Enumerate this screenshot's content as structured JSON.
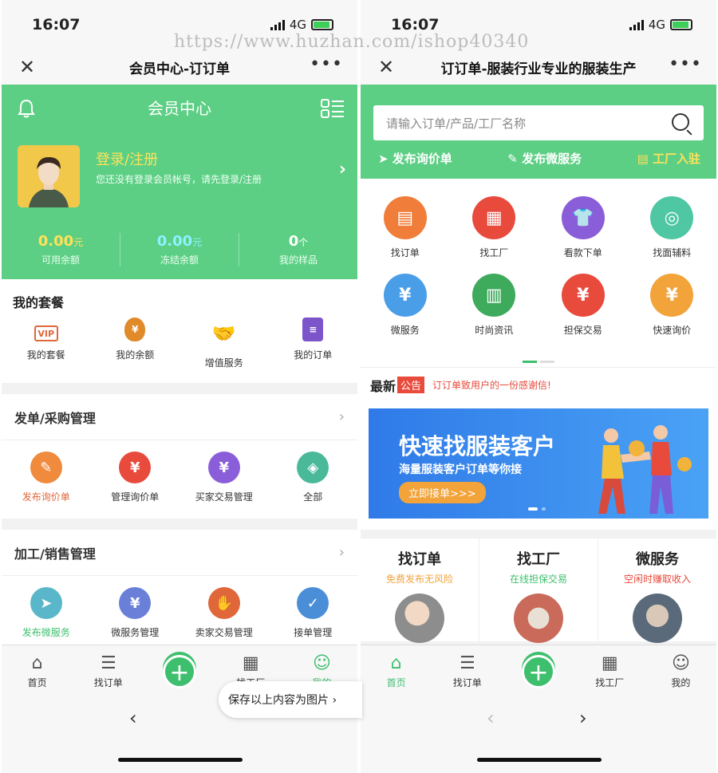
{
  "watermark": "https://www.huzhan.com/ishop40340",
  "left": {
    "status": {
      "time": "16:07",
      "net": "4G"
    },
    "nav": {
      "title": "会员中心-订订单"
    },
    "header": {
      "title": "会员中心",
      "login": "登录/注册",
      "sub": "您还没有登录会员帐号，请先登录/注册"
    },
    "stats": [
      {
        "value": "0.00",
        "unit": "元",
        "label": "可用余额",
        "color": "#ffe25a"
      },
      {
        "value": "0.00",
        "unit": "元",
        "label": "冻结余额",
        "color": "#8ff0ff"
      },
      {
        "value": "0",
        "unit": "个",
        "label": "我的样品",
        "color": "#ffffff"
      }
    ],
    "package": {
      "title": "我的套餐",
      "items": [
        "我的套餐",
        "我的余额",
        "增值服务",
        "我的订单"
      ]
    },
    "purchase": {
      "title": "发单/采购管理",
      "items": [
        "发布询价单",
        "管理询价单",
        "买家交易管理",
        "全部"
      ]
    },
    "sales": {
      "title": "加工/销售管理",
      "items": [
        "发布微服务",
        "微服务管理",
        "卖家交易管理",
        "接单管理"
      ]
    },
    "tabs": [
      "首页",
      "找订单",
      "",
      "找工厂",
      "我的"
    ],
    "save_tip": "保存以上内容为图片 ›"
  },
  "right": {
    "status": {
      "time": "16:07",
      "net": "4G"
    },
    "nav": {
      "title": "订订单-服装行业专业的服装生产"
    },
    "search_placeholder": "请输入订单/产品/工厂名称",
    "links": [
      "发布询价单",
      "发布微服务",
      "工厂入驻"
    ],
    "grid": [
      "找订单",
      "找工厂",
      "看款下单",
      "找面辅料",
      "微服务",
      "时尚资讯",
      "担保交易",
      "快速询价"
    ],
    "notice": {
      "title": "最新",
      "badge": "公告",
      "text": "订订单致用户的一份感谢信!"
    },
    "banner": {
      "title": "快速找服装客户",
      "sub": "海量服装客户订单等你接",
      "button": "立即接单>>>"
    },
    "cards": [
      {
        "title": "找订单",
        "sub": "免费发布无风险",
        "color": "#f2a33a"
      },
      {
        "title": "找工厂",
        "sub": "在线担保交易",
        "color": "#3ebf6e"
      },
      {
        "title": "微服务",
        "sub": "空闲时赚取收入",
        "color": "#e84a3c"
      }
    ],
    "tabs": [
      "首页",
      "找订单",
      "",
      "找工厂",
      "我的"
    ]
  }
}
